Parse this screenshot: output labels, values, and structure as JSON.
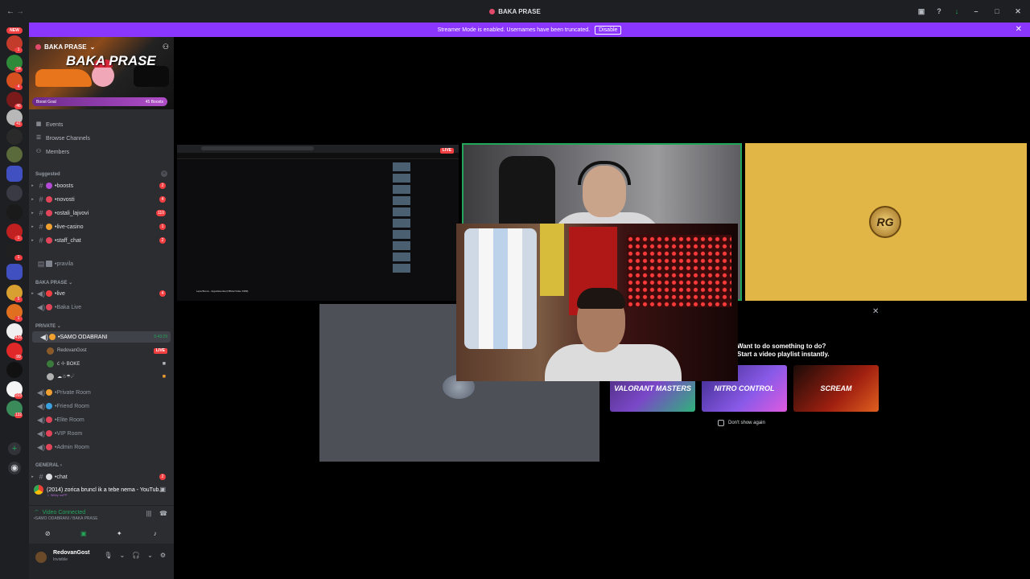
{
  "window": {
    "title": "BAKA PRASE"
  },
  "banner": {
    "message": "Streamer Mode is enabled. Usernames have been truncated.",
    "disable_label": "Disable"
  },
  "rail": {
    "new_label": "NEW",
    "badges": [
      "1",
      "34",
      "4",
      "46",
      "41",
      "1",
      "1",
      "5",
      "1",
      "436",
      "99",
      "203",
      "132"
    ]
  },
  "server": {
    "name": "BAKA PRASE",
    "logo_text": "BAKA PRASE",
    "boost_goal": "Boost Goal",
    "boost_count": "45 Boosts"
  },
  "nav": {
    "events": "Events",
    "browse": "Browse Channels",
    "members": "Members"
  },
  "categories": {
    "suggested": "Suggested",
    "baka_prase": "BAKA PRASE",
    "private": "PRIVATE",
    "general": "GENERAL"
  },
  "suggested_channels": [
    {
      "name": "•boosts",
      "count": "2"
    },
    {
      "name": "•novosti",
      "count": "4"
    },
    {
      "name": "•ostali_lajvovi",
      "count": "110"
    },
    {
      "name": "•live-casino",
      "count": "1"
    },
    {
      "name": "•staff_chat",
      "count": "2"
    }
  ],
  "rules_channel": "•pravila",
  "baka_channels": [
    {
      "name": "•live",
      "count": "4"
    },
    {
      "name": "•Baka Live",
      "count": ""
    }
  ],
  "voice_active": {
    "name": "•SAMO ODABRANI",
    "time": "5:43:29"
  },
  "voice_members": [
    {
      "name": "RedovanGost",
      "tag": "LIVE"
    },
    {
      "name": "ć ☩ BOKE",
      "tag": ""
    },
    {
      "name": "☁☃☂☄",
      "tag": ""
    }
  ],
  "private_channels": [
    "•Private Room",
    "•Friend Room",
    "•Elite Room",
    "•VIP Room",
    "•Admin Room"
  ],
  "general_channels": [
    {
      "name": "•chat",
      "count": "2"
    }
  ],
  "now_playing": {
    "title": "(2014) zorica bruncl ik a tebe nema - YouTub...",
    "sub": "☆ Sibby ooPP"
  },
  "voice_status": {
    "label": "Video Connected",
    "sub": "•SAMO ODABRANI / BAKA PRASE"
  },
  "user": {
    "name": "RedovanGost",
    "status": "Invisible"
  },
  "stage": {
    "screen_live": "LIVE",
    "screen_caption": "Lepa Brena - Jugoslavenka (Official Video 1989)",
    "gold_logo": "RG"
  },
  "activity_popup": {
    "title_line1": "Want to do something to do?",
    "title_line2": "Start a video playlist instantly.",
    "cards": [
      "VALORANT MASTERS",
      "NITRO CONTROL",
      "SCREAM"
    ],
    "dont_show": "Don't show again"
  },
  "colors": {
    "accent_purple": "#8a36ff",
    "sidebar": "#2b2d31",
    "live_red": "#f23f42",
    "connected_green": "#23a55a"
  }
}
